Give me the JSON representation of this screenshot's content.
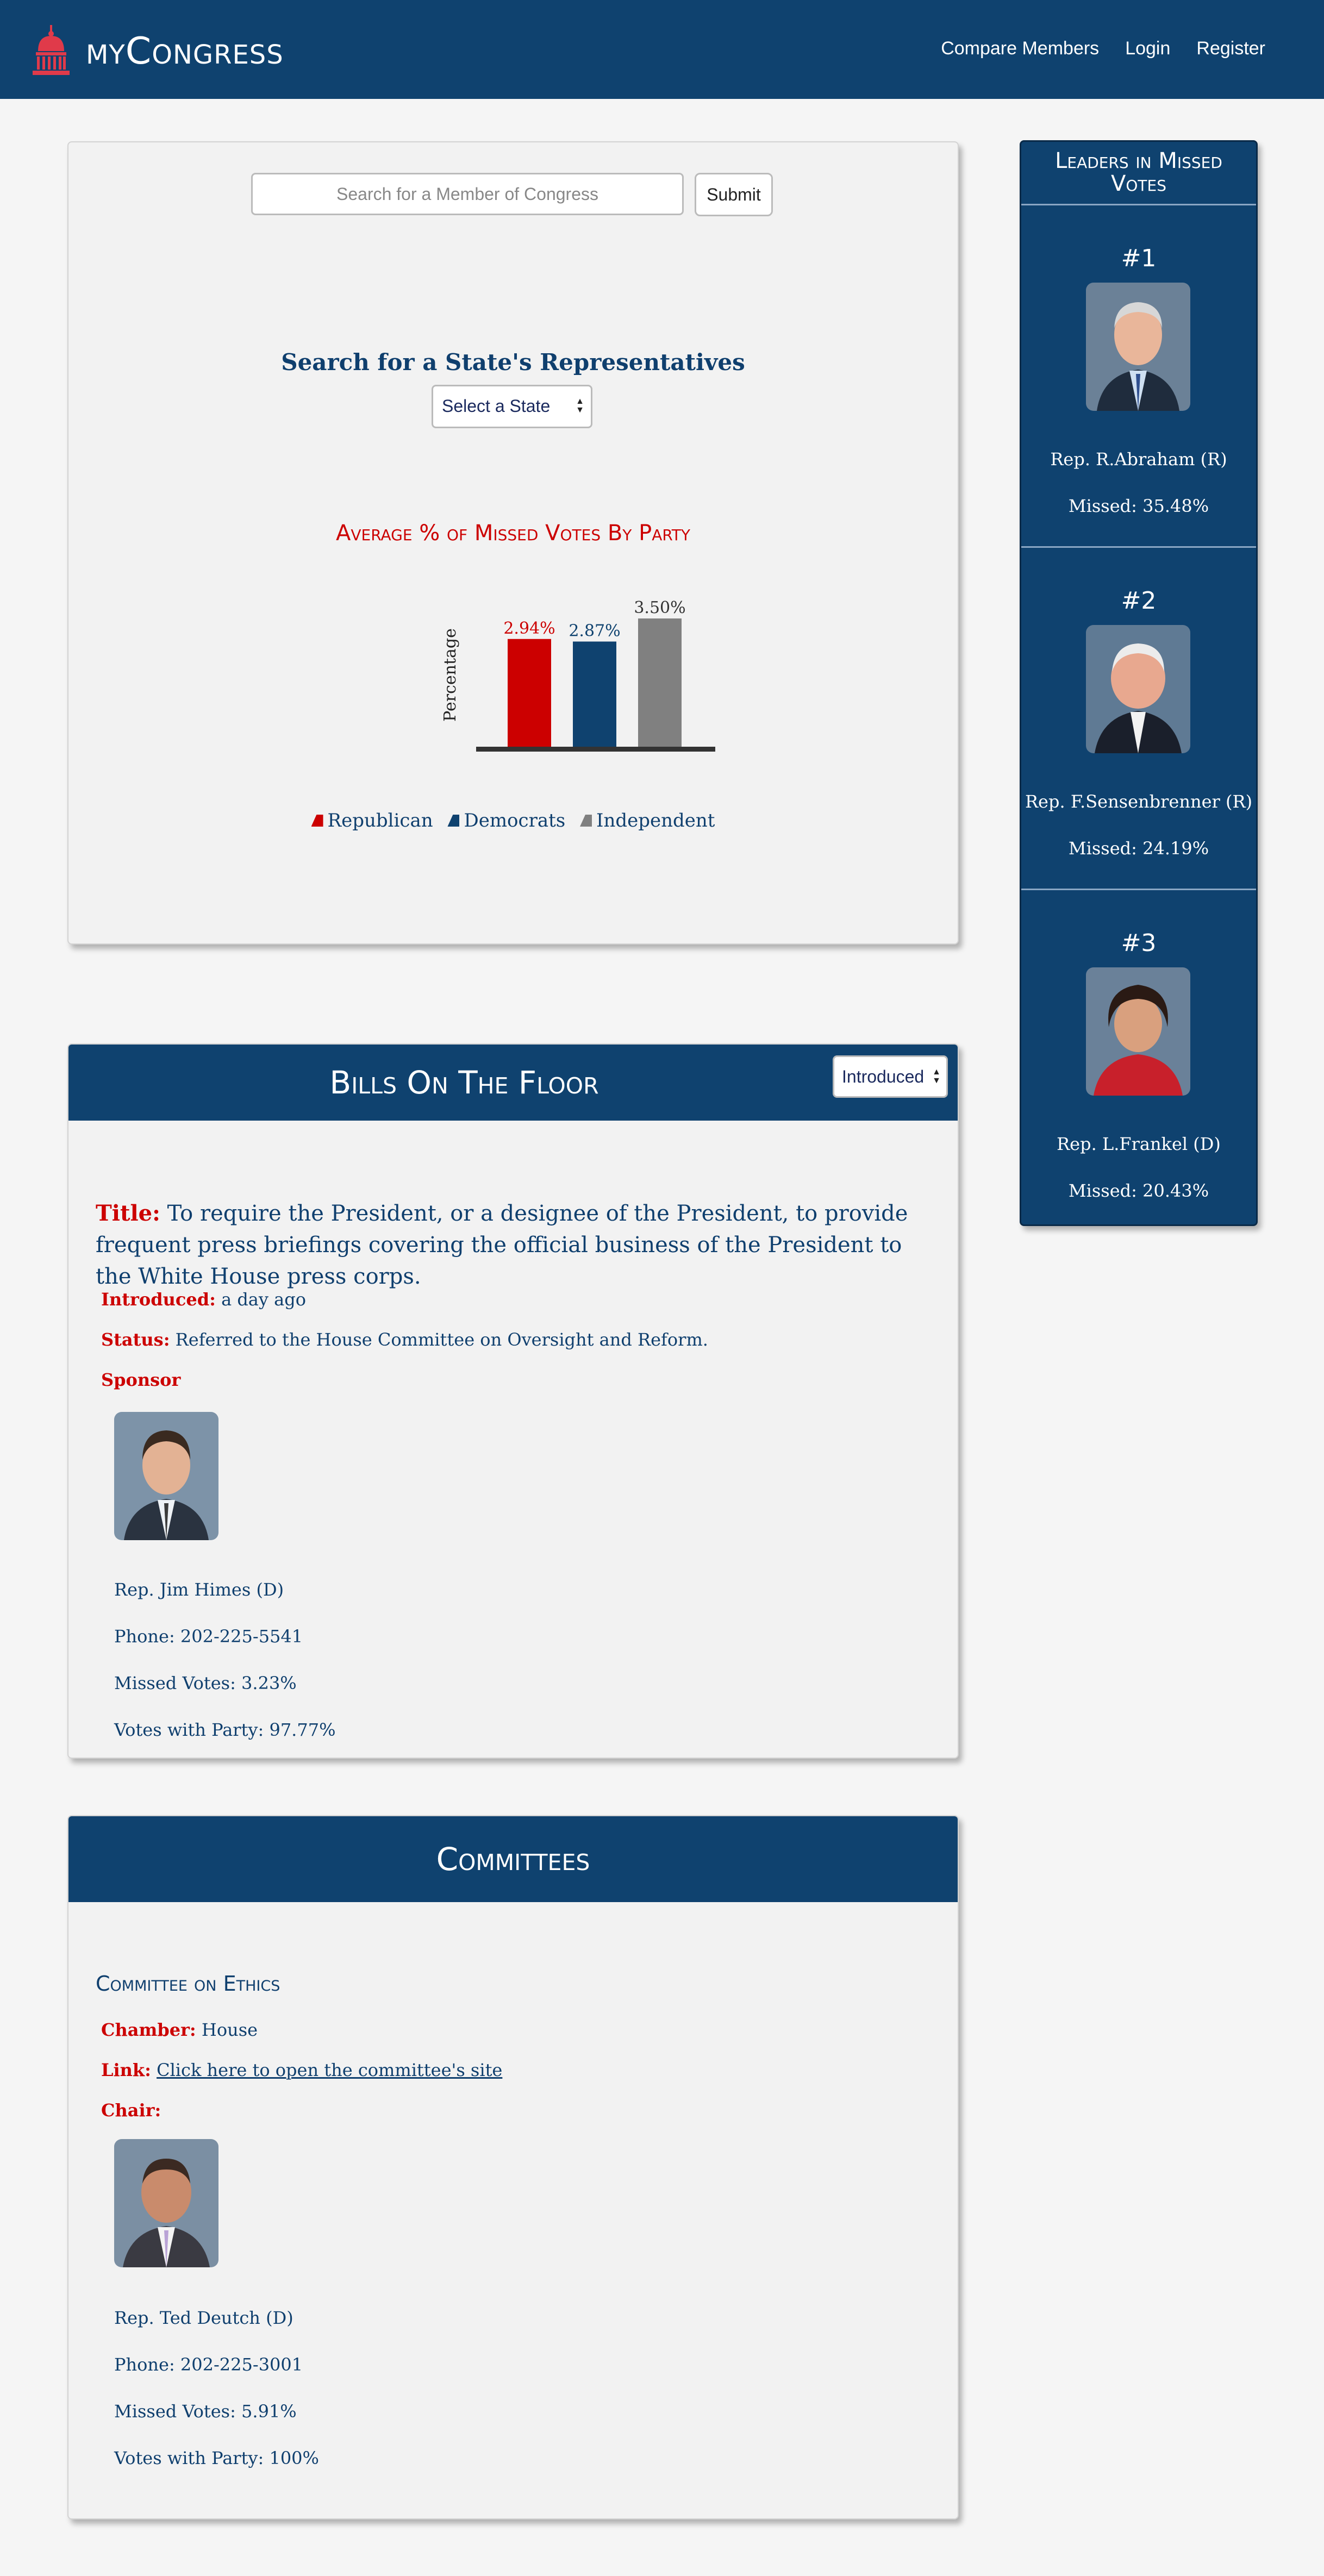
{
  "navbar": {
    "brand": "myCongress",
    "links": [
      "Compare Members",
      "Login",
      "Register"
    ]
  },
  "search": {
    "placeholder": "Search for a Member of Congress",
    "submit_label": "Submit",
    "state_title": "Search for a State's Representatives",
    "state_select": "Select a State"
  },
  "chart_data": {
    "type": "bar",
    "title": "Average % of Missed Votes By Party",
    "ylabel": "Percentage",
    "categories": [
      "Republican",
      "Democrats",
      "Independent"
    ],
    "values": [
      2.94,
      2.87,
      3.5
    ],
    "data_labels": [
      "2.94%",
      "2.87%",
      "3.50%"
    ],
    "colors": [
      "#cc0000",
      "#0f426f",
      "#808080"
    ],
    "ylim": [
      0,
      3.5
    ],
    "grid": false,
    "legend": "bottom"
  },
  "leaders": {
    "title": "Leaders in Missed Votes",
    "items": [
      {
        "rank": "#1",
        "name": "Rep. R.Abraham (R)",
        "missed": "Missed: 35.48%"
      },
      {
        "rank": "#2",
        "name": "Rep. F.Sensenbrenner (R)",
        "missed": "Missed: 24.19%"
      },
      {
        "rank": "#3",
        "name": "Rep. L.Frankel (D)",
        "missed": "Missed: 20.43%"
      }
    ]
  },
  "bills": {
    "title": "Bills On The Floor",
    "filter": "Introduced",
    "bill_title_label": "Title:",
    "bill_title": "To require the President, or a designee of the President, to provide frequent press briefings covering the official business of the President to the White House press corps.",
    "introduced_label": "Introduced:",
    "introduced": "a day ago",
    "status_label": "Status:",
    "status": "Referred to the House Committee on Oversight and Reform.",
    "sponsor_label": "Sponsor",
    "sponsor": {
      "name": "Rep. Jim Himes (D)",
      "phone": "Phone: 202-225-5541",
      "missed": "Missed Votes: 3.23%",
      "party": "Votes with Party: 97.77%"
    }
  },
  "committees": {
    "title": "Committees",
    "name": "Committee on Ethics",
    "chamber_label": "Chamber:",
    "chamber": "House",
    "link_label": "Link:",
    "link_text": "Click here to open the committee's site",
    "chair_label": "Chair:",
    "chair": {
      "name": "Rep. Ted Deutch (D)",
      "phone": "Phone: 202-225-3001",
      "missed": "Missed Votes: 5.91%",
      "party": "Votes with Party: 100%"
    }
  }
}
